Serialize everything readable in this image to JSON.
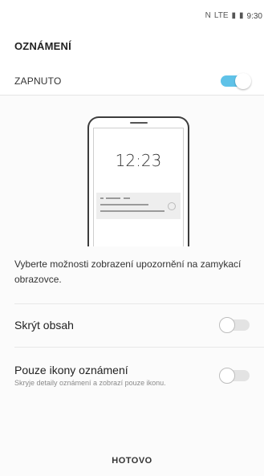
{
  "status_bar": {
    "time": "9:30",
    "network_label": "LTE",
    "icons": [
      "nfc-icon",
      "lte-icon",
      "signal-icon",
      "battery-icon"
    ]
  },
  "title": "OZNÁMENÍ",
  "master": {
    "label": "ZAPNUTO",
    "enabled": true
  },
  "illustration": {
    "clock": "12:23"
  },
  "description": "Vyberte možnosti zobrazení upozornění na zamykací obrazovce.",
  "options": [
    {
      "label": "Skrýt obsah",
      "enabled": false
    },
    {
      "label": "Pouze ikony oznámení",
      "sublabel": "Skryje detaily oznámení a zobrazí pouze ikonu.",
      "enabled": false
    }
  ],
  "done_label": "HOTOVO",
  "colors": {
    "accent": "#5fc2e8",
    "toggle_off": "#e3e3e3",
    "panel": "#fbfbfb"
  }
}
